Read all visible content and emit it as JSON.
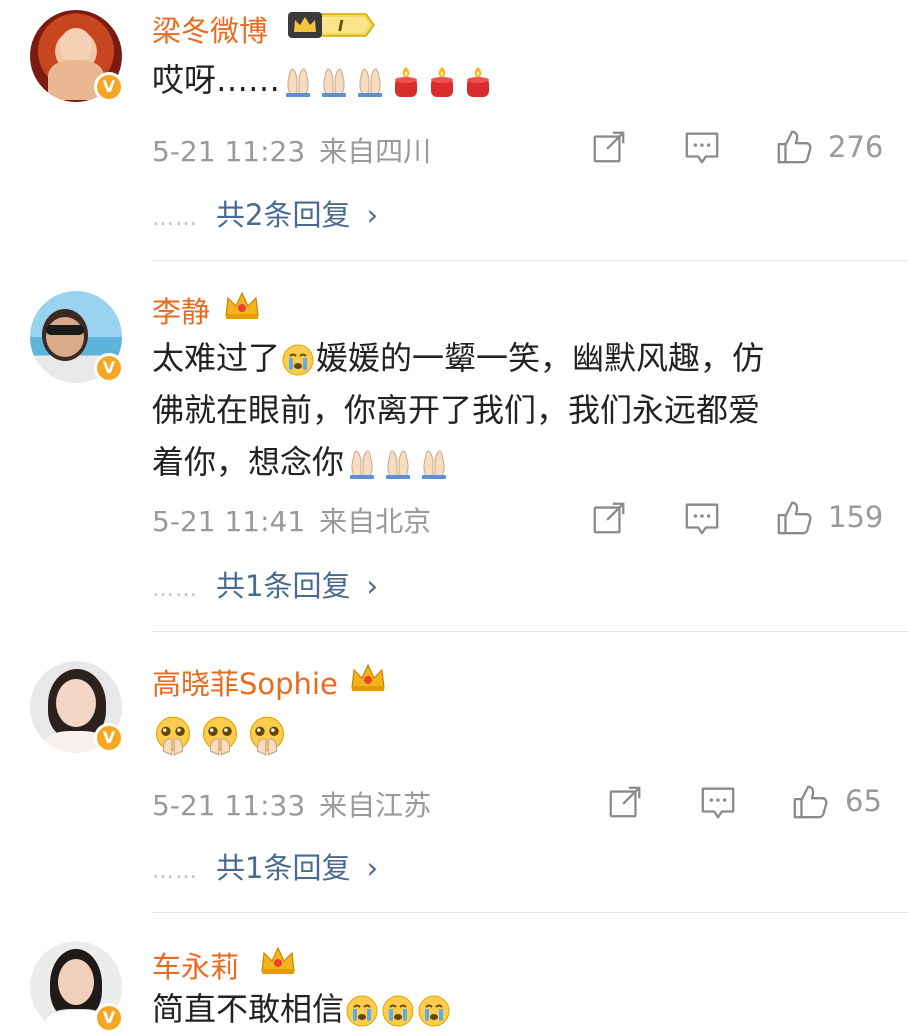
{
  "comments": [
    {
      "username": "梁冬微博",
      "level": "I",
      "text_prefix": "哎呀……",
      "time": "5-21 11:23",
      "location": "来自四川",
      "likes": "276",
      "replies": "共2条回复",
      "emoji": [
        "praying-hands-icon",
        "praying-hands-icon",
        "praying-hands-icon",
        "candle-icon",
        "candle-icon",
        "candle-icon"
      ]
    },
    {
      "username": "李静",
      "text_line1_a": "太难过了",
      "text_line1_b": "媛媛的一颦一笑，幽默风趣，仿",
      "text_line2": "佛就在眼前，你离开了我们，我们永远都爱",
      "text_line3": "着你，想念你",
      "time": "5-21 11:41",
      "location": "来自北京",
      "likes": "159",
      "replies": "共1条回复"
    },
    {
      "username": "高晓菲Sophie",
      "time": "5-21 11:33",
      "location": "来自江苏",
      "likes": "65",
      "replies": "共1条回复"
    },
    {
      "username": "车永莉",
      "text": "简直不敢相信"
    }
  ],
  "ui": {
    "reply_dots": "……",
    "verified_mark": "V",
    "chevron": "›"
  },
  "colors": {
    "username": "#e86b1f",
    "reply_link": "#4a6b91",
    "meta": "#9a9a9a",
    "verified": "#f6a623"
  }
}
